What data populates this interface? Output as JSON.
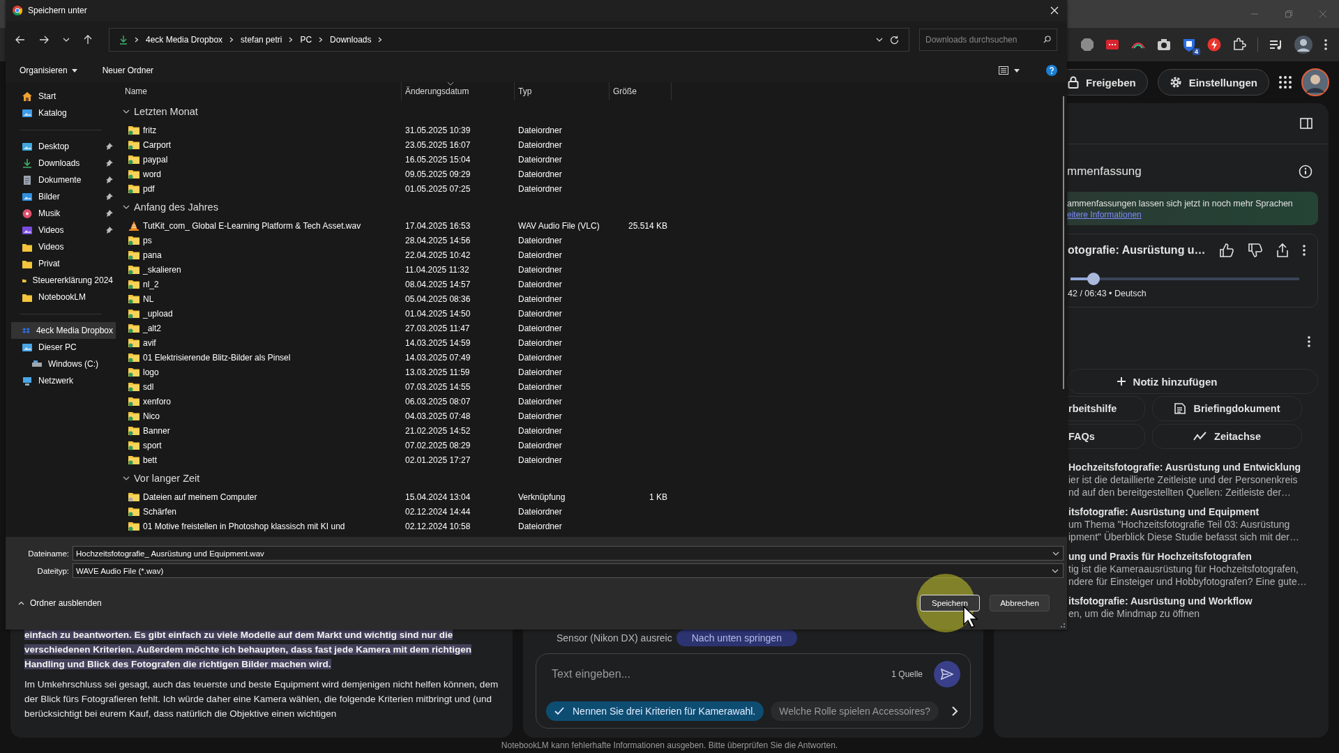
{
  "browser": {
    "extension_badge": "4"
  },
  "app_header": {
    "buttons": [
      {
        "label": "Freigeben",
        "kind": "lock"
      },
      {
        "label": "Einstellungen",
        "kind": "gear"
      }
    ]
  },
  "source_panel": {
    "paragraphs": [
      {
        "text": "einfach zu beantworten. Es gibt einfach zu viele Modelle auf dem Markt und wichtig sind nur die verschiedenen Kriterien. Außerdem möchte ich behaupten, dass fast jede Kamera mit dem richtigen Handling und Blick des Fotografen die richtigen Bilder machen wird.",
        "highlighted": true
      },
      {
        "text": "Im Umkehrschluss sei gesagt, auch das teuerste und beste Equipment wird demjenigen nicht helfen können, dem der Blick fürs Fotografieren fehlt. Ich würde daher eine Kamera wählen, die folgende Kriterien mitbringt und (und berücksichtigt bei eurem Kauf, dass natürlich die Objektive einen wichtigen",
        "highlighted": false
      }
    ]
  },
  "chat_panel": {
    "partial_message": "Sensor (Nikon DX) ausreic",
    "jump_button": "Nach unten springen",
    "input": {
      "placeholder": "Text eingeben..."
    },
    "source_count": "1 Quelle",
    "suggestions": [
      {
        "label": "Nennen Sie drei Kriterien für Kamerawahl.",
        "selected": true
      },
      {
        "label": "Welche Rolle spielen Accessoires?",
        "selected": false
      }
    ]
  },
  "studio_panel": {
    "title": "mmenfassung",
    "notice": {
      "text": "ammenfassungen lassen sich jetzt in noch mehr Sprachen",
      "link": "eitere Informationen"
    },
    "audio": {
      "title": "otografie: Ausrüstung u…",
      "level": 0.1,
      "time": "42 / 06:43 • Deutsch"
    },
    "add_note": "Notiz hinzufügen",
    "tools": [
      {
        "label": "rbeitshilfe",
        "kind": "plain"
      },
      {
        "label": "Briefingdokument",
        "kind": "document"
      },
      {
        "label": "FAQs",
        "kind": "plain"
      },
      {
        "label": "Zeitachse",
        "kind": "timeline"
      }
    ],
    "notes": [
      {
        "title": "Hochzeitsfotografie: Ausrüstung und Entwicklung",
        "lines": [
          "ier ist die detaillierte Zeitleiste und der Personenkreis",
          "nd auf den bereitgestellten Quellen: Zeitleiste der…"
        ]
      },
      {
        "title": "itsfotografie: Ausrüstung und Equipment",
        "lines": [
          "um Thema \"Hochzeitsfotografie Teil 03: Ausrüstung",
          "ipment\" Überblick Diese Studie befasst sich mit der…"
        ]
      },
      {
        "title": "ung und Praxis für Hochzeitsfotografen",
        "lines": [
          "tig ist die Kameraausrüstung für Hochzeitsfotografen,",
          "ndere für Einsteiger und Hobbyfotografen? Eine gute…"
        ]
      },
      {
        "title": "itsfotografie: Ausrüstung und Workflow",
        "lines": [
          "en, um die Mindmap zu öffnen"
        ]
      }
    ]
  },
  "footer": "NotebookLM kann fehlerhafte Informationen ausgeben. Bitte überprüfen Sie die Antworten.",
  "dialog": {
    "title": "Speichern unter",
    "breadcrumb": [
      "4eck Media Dropbox",
      "stefan petri",
      "PC",
      "Downloads"
    ],
    "search": {
      "placeholder": "Downloads durchsuchen"
    },
    "toolbar": [
      {
        "label": "Organisieren",
        "kind": "menu"
      },
      {
        "label": "Neuer Ordner",
        "kind": "plain"
      }
    ],
    "nav_sections": [
      [
        {
          "label": "Start",
          "kind": "home",
          "pinned": false,
          "selected": false
        },
        {
          "label": "Katalog",
          "kind": "gallery",
          "pinned": false,
          "selected": false
        }
      ],
      [
        {
          "label": "Desktop",
          "kind": "desktop",
          "pinned": true,
          "selected": false
        },
        {
          "label": "Downloads",
          "kind": "download",
          "pinned": true,
          "selected": false
        },
        {
          "label": "Dokumente",
          "kind": "documents",
          "pinned": true,
          "selected": false
        },
        {
          "label": "Bilder",
          "kind": "pictures",
          "pinned": true,
          "selected": false
        },
        {
          "label": "Musik",
          "kind": "music",
          "pinned": true,
          "selected": false
        },
        {
          "label": "Videos",
          "kind": "videos",
          "pinned": true,
          "selected": false
        },
        {
          "label": "Videos",
          "kind": "folder",
          "pinned": false,
          "selected": false
        },
        {
          "label": "Privat",
          "kind": "folder",
          "pinned": false,
          "selected": false
        },
        {
          "label": "Steuererklärung 2024",
          "kind": "folder",
          "pinned": false,
          "selected": false
        },
        {
          "label": "NotebookLM",
          "kind": "folder",
          "pinned": false,
          "selected": false
        }
      ],
      [
        {
          "label": "4eck Media Dropbox",
          "kind": "dropbox",
          "pinned": false,
          "selected": true
        },
        {
          "label": "Dieser PC",
          "kind": "pc",
          "pinned": false,
          "selected": false,
          "children": [
            {
              "label": "Windows (C:)",
              "kind": "drive",
              "pinned": false,
              "selected": false
            }
          ]
        },
        {
          "label": "Netzwerk",
          "kind": "network",
          "pinned": false,
          "selected": false
        }
      ]
    ],
    "columns": [
      "Name",
      "Änderungsdatum",
      "Typ",
      "Größe"
    ],
    "groups": [
      {
        "label": "Letzten Monat",
        "expanded": true,
        "rows": [
          {
            "name": "fritz",
            "kind": "folder",
            "date": "31.05.2025 10:39",
            "type": "Dateiordner"
          },
          {
            "name": "Carport",
            "kind": "folder",
            "date": "23.05.2025 16:07",
            "type": "Dateiordner"
          },
          {
            "name": "paypal",
            "kind": "folder",
            "date": "16.05.2025 15:04",
            "type": "Dateiordner"
          },
          {
            "name": "word",
            "kind": "folder",
            "date": "09.05.2025 09:29",
            "type": "Dateiordner"
          },
          {
            "name": "pdf",
            "kind": "folder",
            "date": "01.05.2025 07:25",
            "type": "Dateiordner"
          }
        ]
      },
      {
        "label": "Anfang des Jahres",
        "expanded": true,
        "rows": [
          {
            "name": "TutKit_com_ Global E-Learning Platform & Tech Asset.wav",
            "kind": "audio",
            "date": "17.04.2025 16:53",
            "type": "WAV Audio File (VLC)",
            "size": "25.514 KB"
          },
          {
            "name": "ps",
            "kind": "folder",
            "date": "28.04.2025 14:56",
            "type": "Dateiordner"
          },
          {
            "name": "pana",
            "kind": "folder",
            "date": "22.04.2025 10:42",
            "type": "Dateiordner"
          },
          {
            "name": "_skalieren",
            "kind": "folder",
            "date": "11.04.2025 11:32",
            "type": "Dateiordner"
          },
          {
            "name": "nl_2",
            "kind": "folder",
            "date": "08.04.2025 14:57",
            "type": "Dateiordner"
          },
          {
            "name": "NL",
            "kind": "folder",
            "date": "05.04.2025 08:36",
            "type": "Dateiordner"
          },
          {
            "name": "_upload",
            "kind": "folder",
            "date": "01.04.2025 14:50",
            "type": "Dateiordner"
          },
          {
            "name": "_alt2",
            "kind": "folder",
            "date": "27.03.2025 11:47",
            "type": "Dateiordner"
          },
          {
            "name": "avif",
            "kind": "folder",
            "date": "14.03.2025 14:59",
            "type": "Dateiordner"
          },
          {
            "name": "01 Elektrisierende Blitz-Bilder als Pinsel",
            "kind": "folder",
            "date": "14.03.2025 07:49",
            "type": "Dateiordner"
          },
          {
            "name": "logo",
            "kind": "folder",
            "date": "13.03.2025 11:59",
            "type": "Dateiordner"
          },
          {
            "name": "sdl",
            "kind": "folder",
            "date": "07.03.2025 14:55",
            "type": "Dateiordner"
          },
          {
            "name": "xenforo",
            "kind": "folder",
            "date": "06.03.2025 08:07",
            "type": "Dateiordner"
          },
          {
            "name": "Nico",
            "kind": "folder",
            "date": "04.03.2025 07:48",
            "type": "Dateiordner"
          },
          {
            "name": "Banner",
            "kind": "folder",
            "date": "21.02.2025 14:52",
            "type": "Dateiordner"
          },
          {
            "name": "sport",
            "kind": "folder",
            "date": "07.02.2025 08:29",
            "type": "Dateiordner"
          },
          {
            "name": "bett",
            "kind": "folder",
            "date": "02.01.2025 17:27",
            "type": "Dateiordner"
          }
        ]
      },
      {
        "label": "Vor langer Zeit",
        "expanded": true,
        "rows": [
          {
            "name": "Dateien auf meinem Computer",
            "kind": "shortcut",
            "date": "15.04.2024 13:04",
            "type": "Verknüpfung",
            "size": "1 KB"
          },
          {
            "name": "Schärfen",
            "kind": "folder",
            "date": "02.12.2024 14:44",
            "type": "Dateiordner"
          },
          {
            "name": "01 Motive freistellen in Photoshop klassisch mit KI und",
            "kind": "folder",
            "date": "02.12.2024 10:58",
            "type": "Dateiordner"
          }
        ]
      }
    ],
    "filename": {
      "label": "Dateiname:",
      "value": "Hochzeitsfotografie_ Ausrüstung und Equipment.wav"
    },
    "filetype": {
      "label": "Dateityp:",
      "value": "WAVE Audio File (*.wav)"
    },
    "hide_folders": "Ordner ausblenden",
    "buttons": [
      {
        "label": "Speichern",
        "kind": "primary"
      },
      {
        "label": "Abbrechen",
        "kind": "secondary"
      }
    ]
  }
}
